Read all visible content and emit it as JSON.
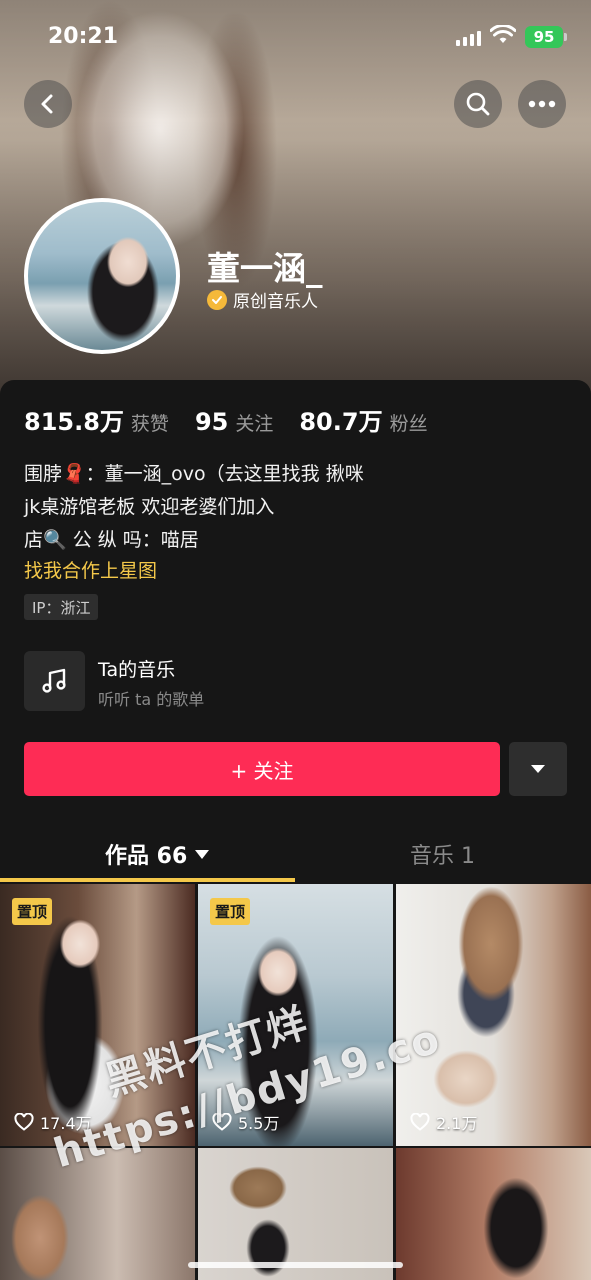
{
  "status_bar": {
    "time": "20:21",
    "battery": "95"
  },
  "profile": {
    "name": "董一涵_",
    "verification": "原创音乐人"
  },
  "stats": [
    {
      "value": "815.8万",
      "label": "获赞"
    },
    {
      "value": "95",
      "label": "关注"
    },
    {
      "value": "80.7万",
      "label": "粉丝"
    }
  ],
  "bio": {
    "lines": [
      "围脖🧣：董一涵_ovo（去这里找我 揪咪",
      "jk桌游馆老板 欢迎老婆们加入",
      "店🔍 公 纵 吗：喵居"
    ],
    "link": "找我合作上星图",
    "ip": "IP：浙江"
  },
  "music_entry": {
    "title": "Ta的音乐",
    "subtitle": "听听 ta 的歌单"
  },
  "follow_button": "+ 关注",
  "tabs": {
    "works": "作品 66",
    "music": "音乐 1"
  },
  "videos": [
    {
      "pinned": "置顶",
      "likes": "17.4万"
    },
    {
      "pinned": "置顶",
      "likes": "5.5万"
    },
    {
      "pinned": "",
      "likes": "2.1万"
    },
    {
      "pinned": "",
      "likes": ""
    },
    {
      "pinned": "",
      "likes": ""
    },
    {
      "pinned": "",
      "likes": ""
    }
  ],
  "watermark": {
    "line1": "黑料不打烊",
    "line2": "https://bdy19.co"
  },
  "colors": {
    "accent": "#fe2c55",
    "highlight": "#f4c84a",
    "background": "#161616"
  }
}
